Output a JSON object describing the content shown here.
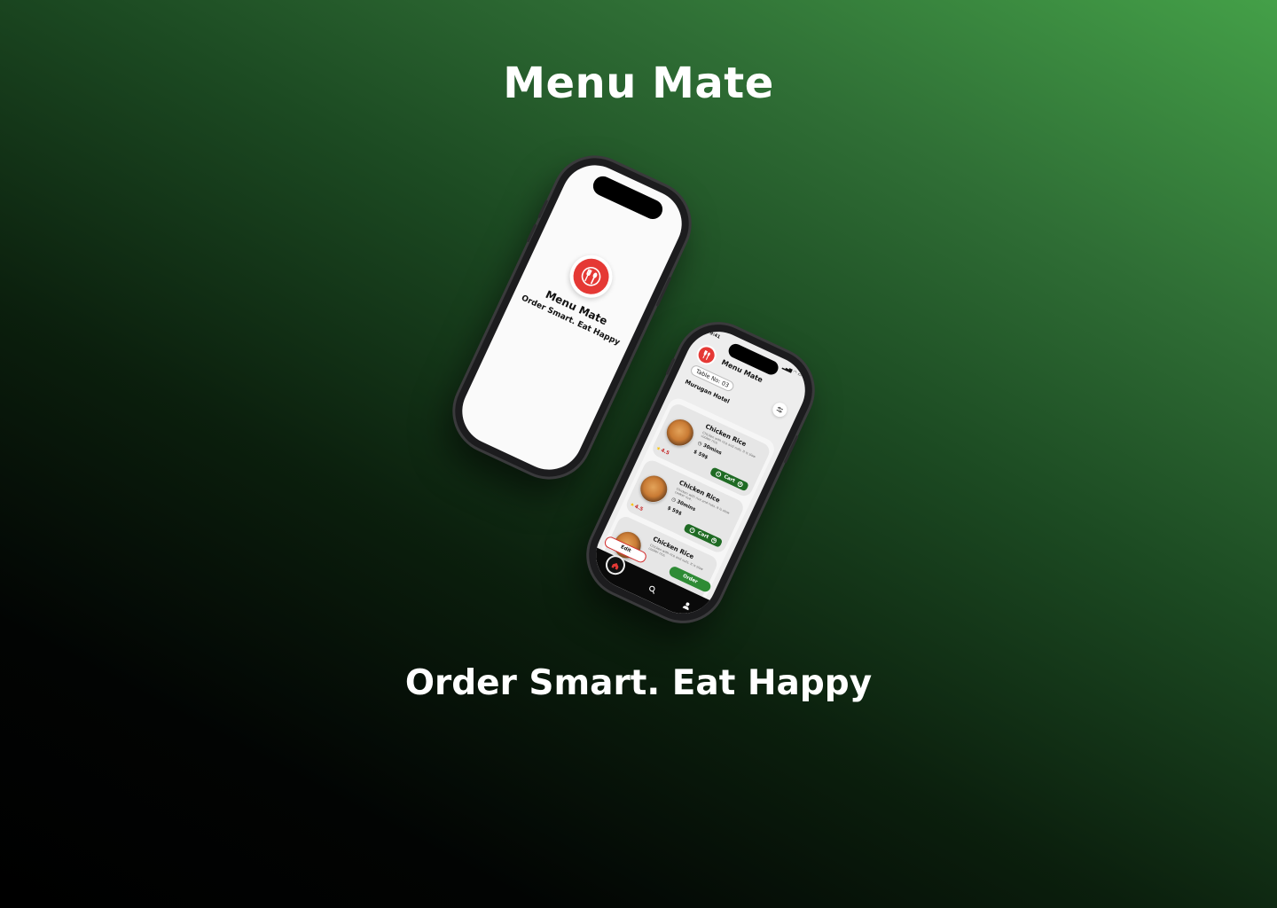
{
  "page": {
    "title": "Menu Mate",
    "tagline": "Order Smart. Eat Happy"
  },
  "splash": {
    "app_name": "Menu Mate",
    "tagline": "Order Smart. Eat Happy"
  },
  "app": {
    "status_time": "9:41",
    "title": "Menu Mate",
    "table_label": "Table No: 03",
    "hotel_name": "Murugan Hotel",
    "items": [
      {
        "name": "Chicken Rice",
        "description": "Chicken with rice and nuts. It is slow cooker rice.",
        "time": "30mins",
        "price": "59$",
        "rating": "4.5",
        "cart_label": "Cart"
      },
      {
        "name": "Chicken Rice",
        "description": "Chicken with rice and nuts. It is slow cooker rice.",
        "time": "30mins",
        "price": "59$",
        "rating": "4.5",
        "cart_label": "Cart"
      },
      {
        "name": "Chicken Rice",
        "description": "Chicken with rice and nuts. It is slow cooker rice.",
        "time": "",
        "price": "",
        "rating": "",
        "cart_label": ""
      }
    ],
    "edit_label": "Edit",
    "order_label": "Order",
    "tabs": [
      "home-icon",
      "search-icon",
      "profile-icon"
    ]
  },
  "colors": {
    "accent_green": "#2e8b35",
    "brand_red": "#e53935",
    "rating_red": "#c62828",
    "star_yellow": "#f9c000"
  }
}
